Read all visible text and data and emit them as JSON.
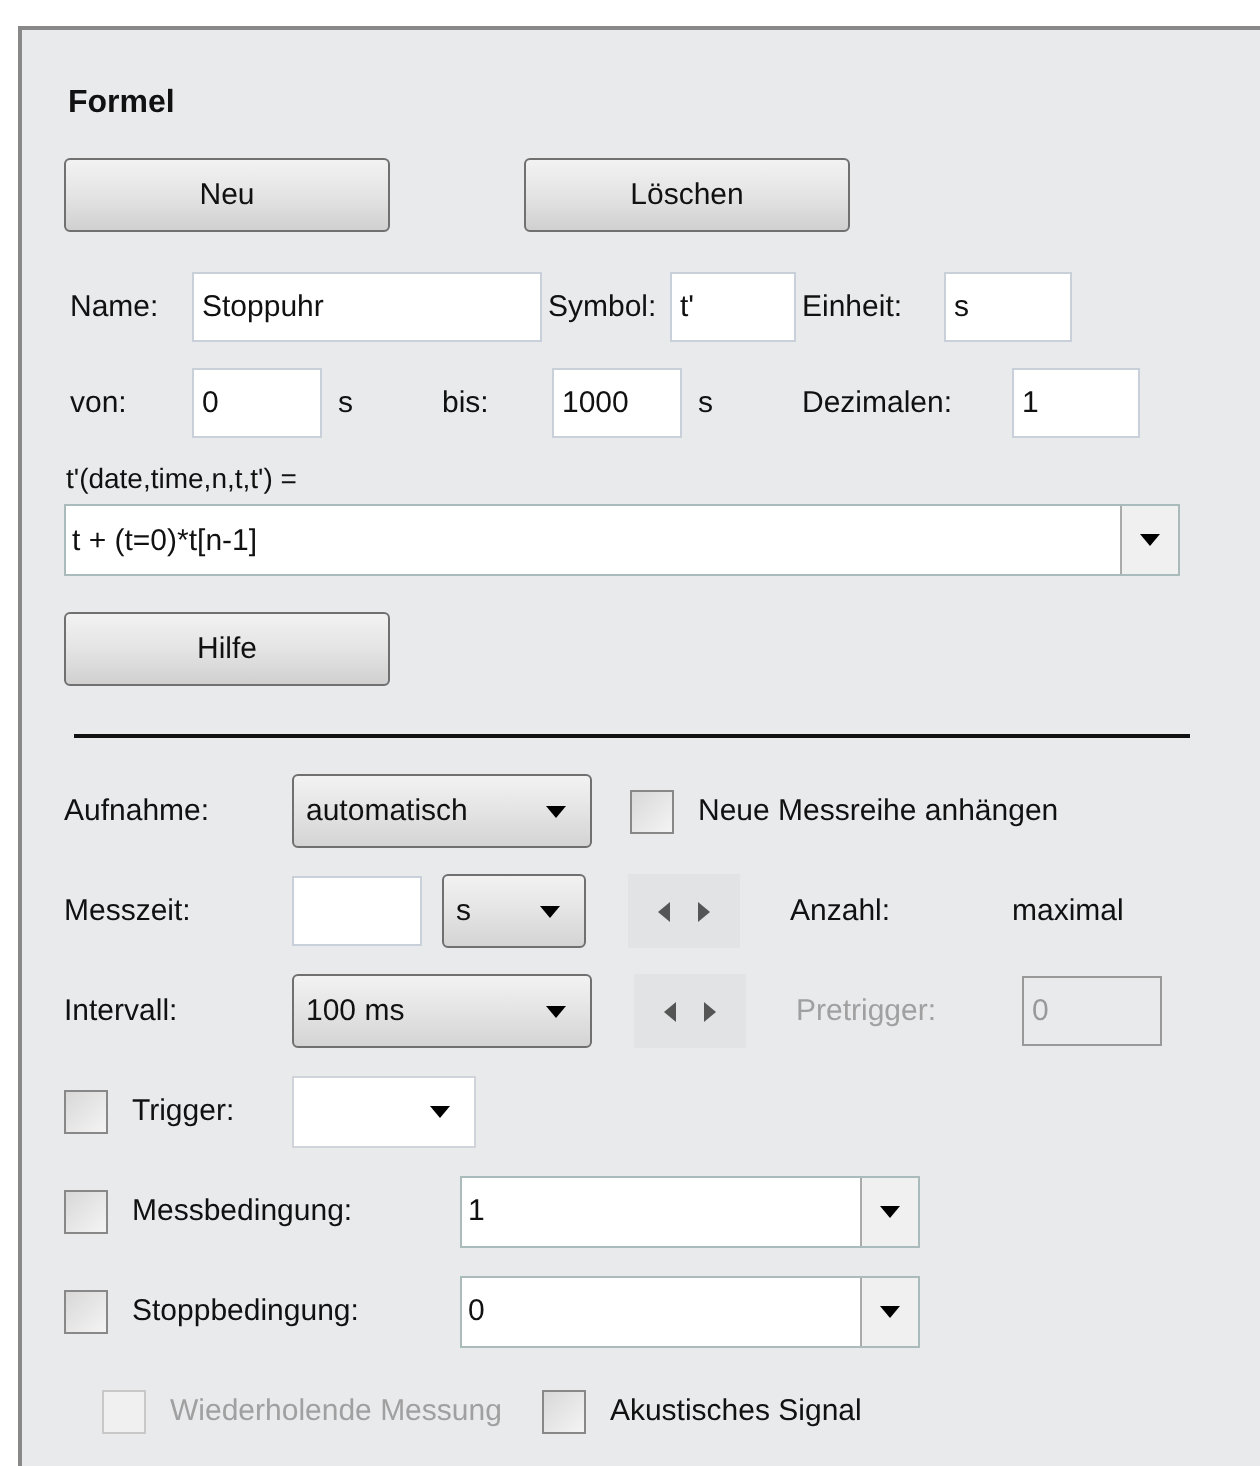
{
  "section": {
    "title": "Formel"
  },
  "top_buttons": [
    {
      "label": "Neu"
    },
    {
      "label": "Löschen"
    }
  ],
  "name_row": [
    {
      "label": "Name:",
      "value": "Stoppuhr"
    },
    {
      "label": "Symbol:",
      "value": "t'"
    },
    {
      "label": "Einheit:",
      "value": "s"
    }
  ],
  "range_row": [
    {
      "label": "von:",
      "value": "0",
      "unit": "s"
    },
    {
      "label": "bis:",
      "value": "1000",
      "unit": "s"
    },
    {
      "label": "Dezimalen:",
      "value": "1"
    }
  ],
  "formula": {
    "label": "t'(date,time,n,t,t') =",
    "value": "t + (t=0)*t[n-1]"
  },
  "help_button": {
    "label": "Hilfe"
  },
  "aufnahme": {
    "label": "Aufnahme:",
    "value": "automatisch"
  },
  "append": {
    "label": "Neue Messreihe anhängen",
    "checked": false
  },
  "messzeit": {
    "label": "Messzeit:",
    "unit": "s"
  },
  "anzahl": {
    "label": "Anzahl:",
    "value": "maximal"
  },
  "intervall": {
    "label": "Intervall:",
    "value": "100 ms"
  },
  "pretrigger": {
    "label": "Pretrigger:",
    "value": "0",
    "disabled": true
  },
  "conditions": [
    {
      "kind": "dropdown",
      "label": "Trigger:",
      "checked": false
    },
    {
      "kind": "combo",
      "label": "Messbedingung:",
      "value": "1",
      "checked": false
    },
    {
      "kind": "combo",
      "label": "Stoppbedingung:",
      "value": "0",
      "checked": false
    }
  ],
  "options": [
    {
      "label": "Wiederholende Messung",
      "checked": false,
      "disabled": true
    },
    {
      "label": "Akustisches Signal",
      "checked": false,
      "disabled": false
    }
  ]
}
